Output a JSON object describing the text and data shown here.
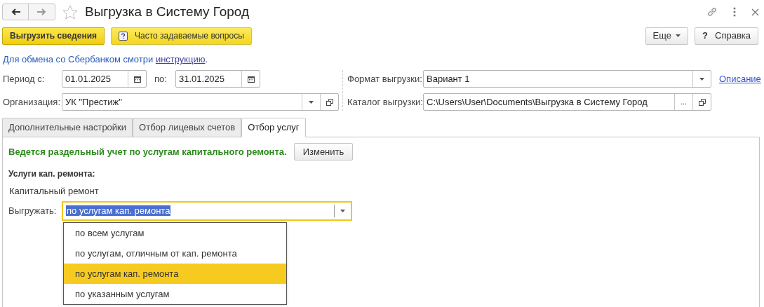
{
  "window": {
    "title": "Выгрузка в Систему Город",
    "favorite": false
  },
  "toolbar": {
    "primary": "Выгрузить сведения",
    "faq": "Часто задаваемые вопросы",
    "more": "Еще",
    "help_mark": "?",
    "help": "Справка"
  },
  "notice": {
    "text": "Для обмена со Сбербанком смотри ",
    "link": "инструкцию",
    "end": "."
  },
  "period": {
    "label_from": "Период с:",
    "from": "01.01.2025",
    "label_to": "по:",
    "to": "31.01.2025"
  },
  "organization": {
    "label": "Организация:",
    "value": "УК \"Престиж\""
  },
  "format": {
    "label": "Формат выгрузки:",
    "value": "Вариант 1",
    "link": "Описание"
  },
  "catalog": {
    "label": "Каталог выгрузки:",
    "value": "C:\\Users\\User\\Documents\\Выгрузка в Систему Город",
    "button": "..."
  },
  "tabs": [
    {
      "label": "Дополнительные настройки",
      "selected": false
    },
    {
      "label": "Отбор лицевых счетов",
      "selected": false
    },
    {
      "label": "Отбор услуг",
      "selected": true
    }
  ],
  "panel": {
    "message": "Ведется раздельный учет по услугам капитального ремонта.",
    "change": "Изменить",
    "services_label": "Услуги кап. ремонта:",
    "service": "Капитальный ремонт",
    "export_label": "Выгружать:",
    "export_value": "по услугам кап. ремонта"
  },
  "dropdown": {
    "expanded": true,
    "options": [
      {
        "label": "по всем услугам",
        "selected": false
      },
      {
        "label": "по услугам, отличным от кап. ремонта",
        "selected": false
      },
      {
        "label": "по услугам кап. ремонта",
        "selected": true
      },
      {
        "label": "по указанным услугам",
        "selected": false
      }
    ]
  }
}
